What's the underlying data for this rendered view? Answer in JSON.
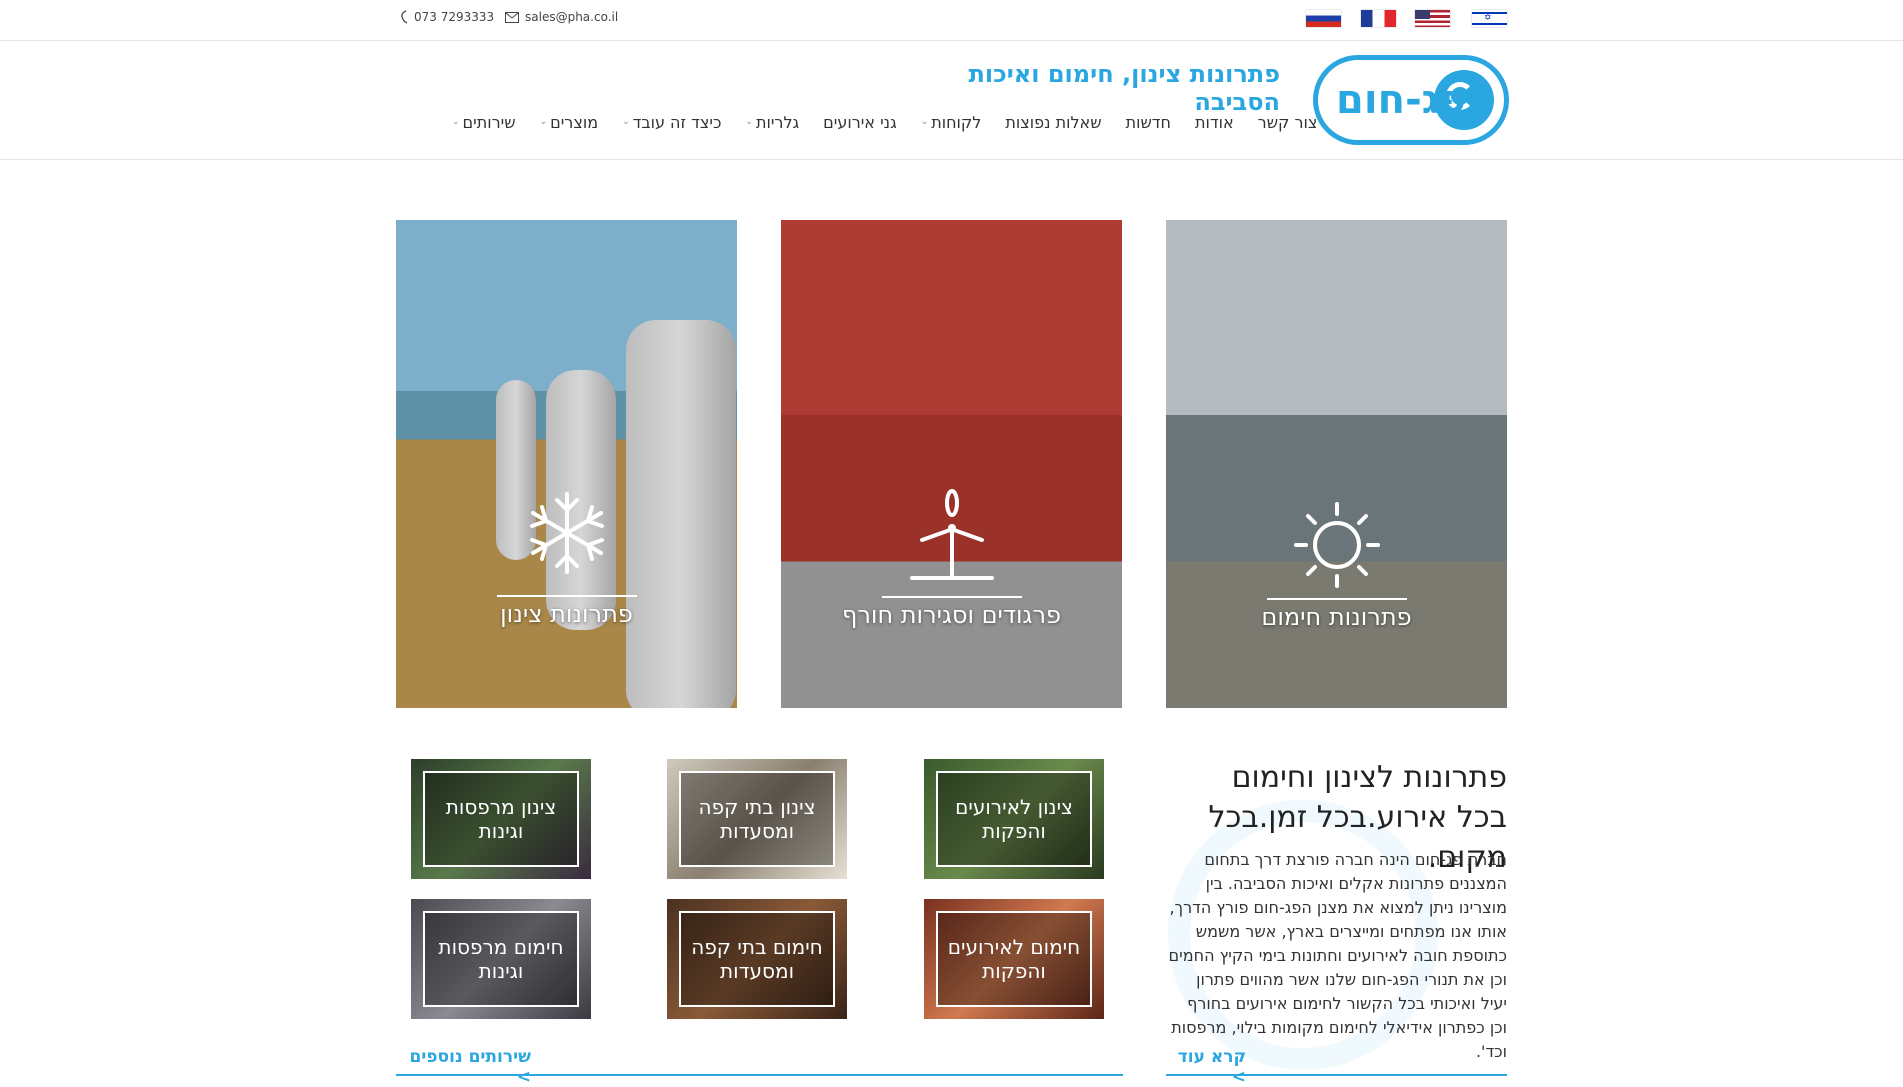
{
  "topbar": {
    "phone": "073 7293333",
    "email": "sales@pha.co.il",
    "flags": [
      "flag-ru-icon",
      "flag-fr-icon",
      "flag-us-icon",
      "flag-il-icon"
    ]
  },
  "header": {
    "logo_text": "פג-חום",
    "tagline": "פתרונות צינון, חימום ואיכות הסביבה",
    "nav": [
      {
        "label": "שירותים",
        "dropdown": true
      },
      {
        "label": "מוצרים",
        "dropdown": true
      },
      {
        "label": "כיצד זה עובד",
        "dropdown": true
      },
      {
        "label": "גלריות",
        "dropdown": true
      },
      {
        "label": "גני אירועים",
        "dropdown": false
      },
      {
        "label": "לקוחות",
        "dropdown": true
      },
      {
        "label": "שאלות נפוצות",
        "dropdown": false
      },
      {
        "label": "חדשות",
        "dropdown": false
      },
      {
        "label": "אודות",
        "dropdown": false
      },
      {
        "label": "צור קשר",
        "dropdown": false
      }
    ]
  },
  "tiles": {
    "heating": "פתרונות חימום",
    "awnings": "פרגודים וסגירות חורף",
    "cooling": "פתרונות צינון"
  },
  "small_tiles": [
    {
      "label": "צינון לאירועים והפקות"
    },
    {
      "label": "צינון בתי קפה ומסעדות"
    },
    {
      "label": "צינון מרפסות וגינות"
    },
    {
      "label": "חימום לאירועים והפקות"
    },
    {
      "label": "חימום בתי קפה ומסעדות"
    },
    {
      "label": "חימום מרפסות וגינות"
    }
  ],
  "about": {
    "title_line1": "פתרונות לצינון וחימום",
    "title_line2": "בכל אירוע.בכל זמן.בכל מקום.",
    "body": "חברת פג-חום הינה חברה פורצת דרך בתחום המצננים פתרונות אקלים ואיכות הסביבה. בין מוצרינו ניתן למצוא את מצנן הפג-חום פורץ הדרך, אותו אנו מפתחים ומייצרים בארץ, אשר משמש כתוספת חובה לאירועים וחתונות בימי הקיץ החמים וכן את תנורי הפג-חום שלנו אשר מהווים פתרון יעיל ואיכותי בכל הקשור לחימום אירועים בחורף וכן כפתרון אידיאלי לחימום מקומות בילוי, מרפסות וכד'.",
    "read_more": "קרא עוד >",
    "more_services": "שירותים נוספים >"
  },
  "colors": {
    "accent": "#2aa6e0"
  }
}
